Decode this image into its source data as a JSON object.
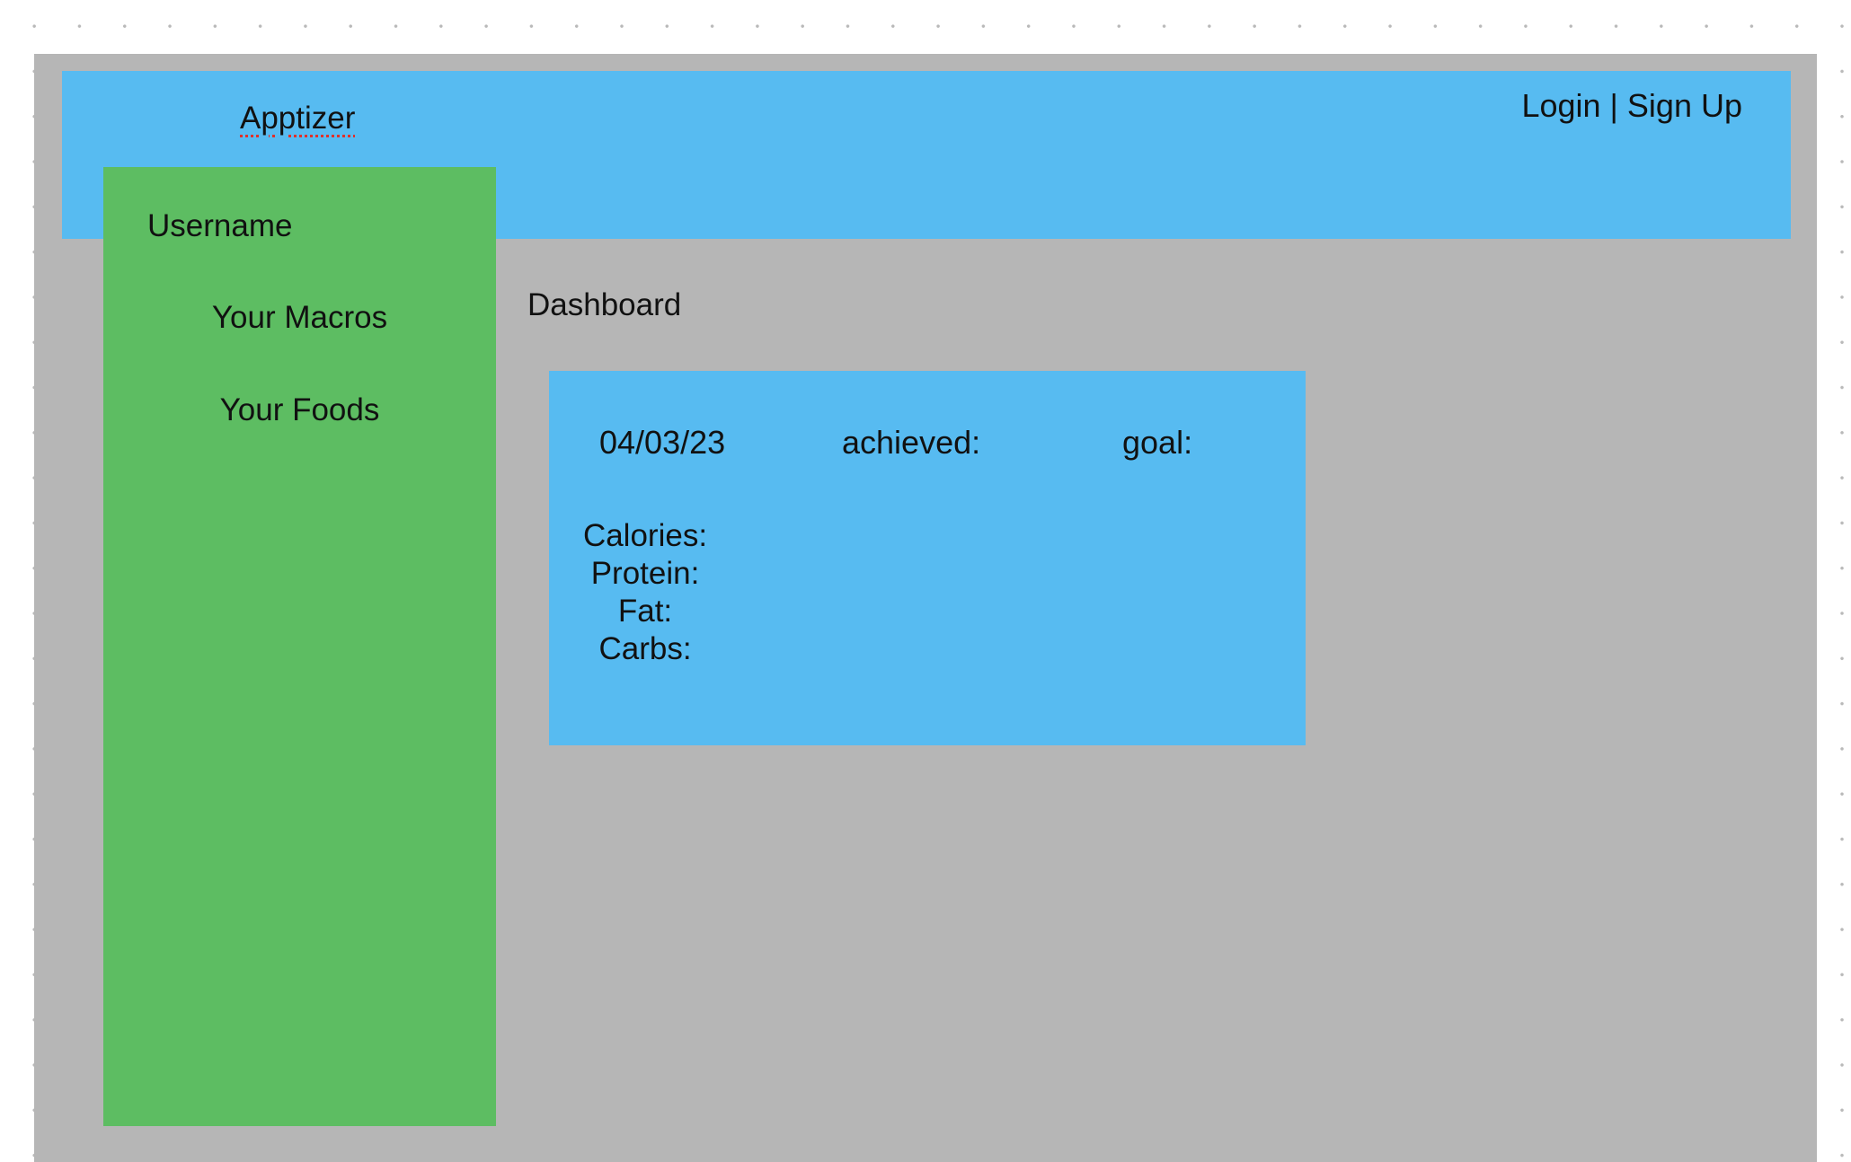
{
  "header": {
    "app_name": "Apptizer",
    "login_label": "Login",
    "separator": "|",
    "signup_label": "Sign Up"
  },
  "sidebar": {
    "username": "Username",
    "items": [
      {
        "label": "Your Macros"
      },
      {
        "label": "Your Foods"
      }
    ]
  },
  "main": {
    "title": "Dashboard",
    "card": {
      "date": "04/03/23",
      "achieved_label": "achieved:",
      "goal_label": "goal:",
      "macros": [
        "Calories:",
        "Protein:",
        "Fat:",
        "Carbs:"
      ]
    }
  },
  "colors": {
    "canvas": "#b6b6b6",
    "header": "#57bbf1",
    "sidebar": "#5dbd62",
    "card": "#57bbf1"
  }
}
